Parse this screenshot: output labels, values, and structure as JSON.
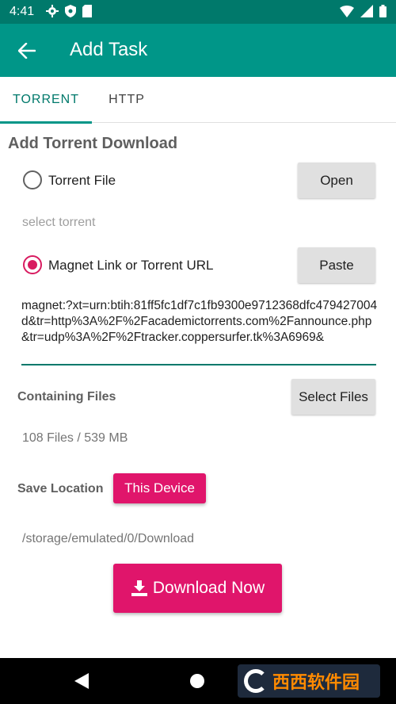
{
  "status_bar": {
    "time": "4:41"
  },
  "app_bar": {
    "title": "Add Task"
  },
  "tabs": [
    {
      "label": "TORRENT"
    },
    {
      "label": "HTTP"
    }
  ],
  "form": {
    "heading": "Add Torrent Download",
    "torrent_file": {
      "label": "Torrent File",
      "button": "Open",
      "selected": false
    },
    "select_hint": "select torrent",
    "magnet": {
      "label": "Magnet Link or Torrent URL",
      "button": "Paste",
      "selected": true,
      "value": "magnet:?xt=urn:btih:81ff5fc1df7c1fb9300e9712368dfc479427004d&tr=http%3A%2F%2Facademictorrents.com%2Fannounce.php&tr=udp%3A%2F%2Ftracker.coppersurfer.tk%3A6969&"
    },
    "containing_files": {
      "label": "Containing Files",
      "button": "Select Files",
      "summary": "108 Files / 539 MB"
    },
    "save_location": {
      "label": "Save Location",
      "button": "This Device",
      "path": "/storage/emulated/0/Download"
    },
    "download_button": "Download Now"
  },
  "watermark": {
    "text": "西西软件园"
  },
  "colors": {
    "primary": "#009688",
    "primary_dark": "#00796b",
    "accent": "#e0156b"
  }
}
